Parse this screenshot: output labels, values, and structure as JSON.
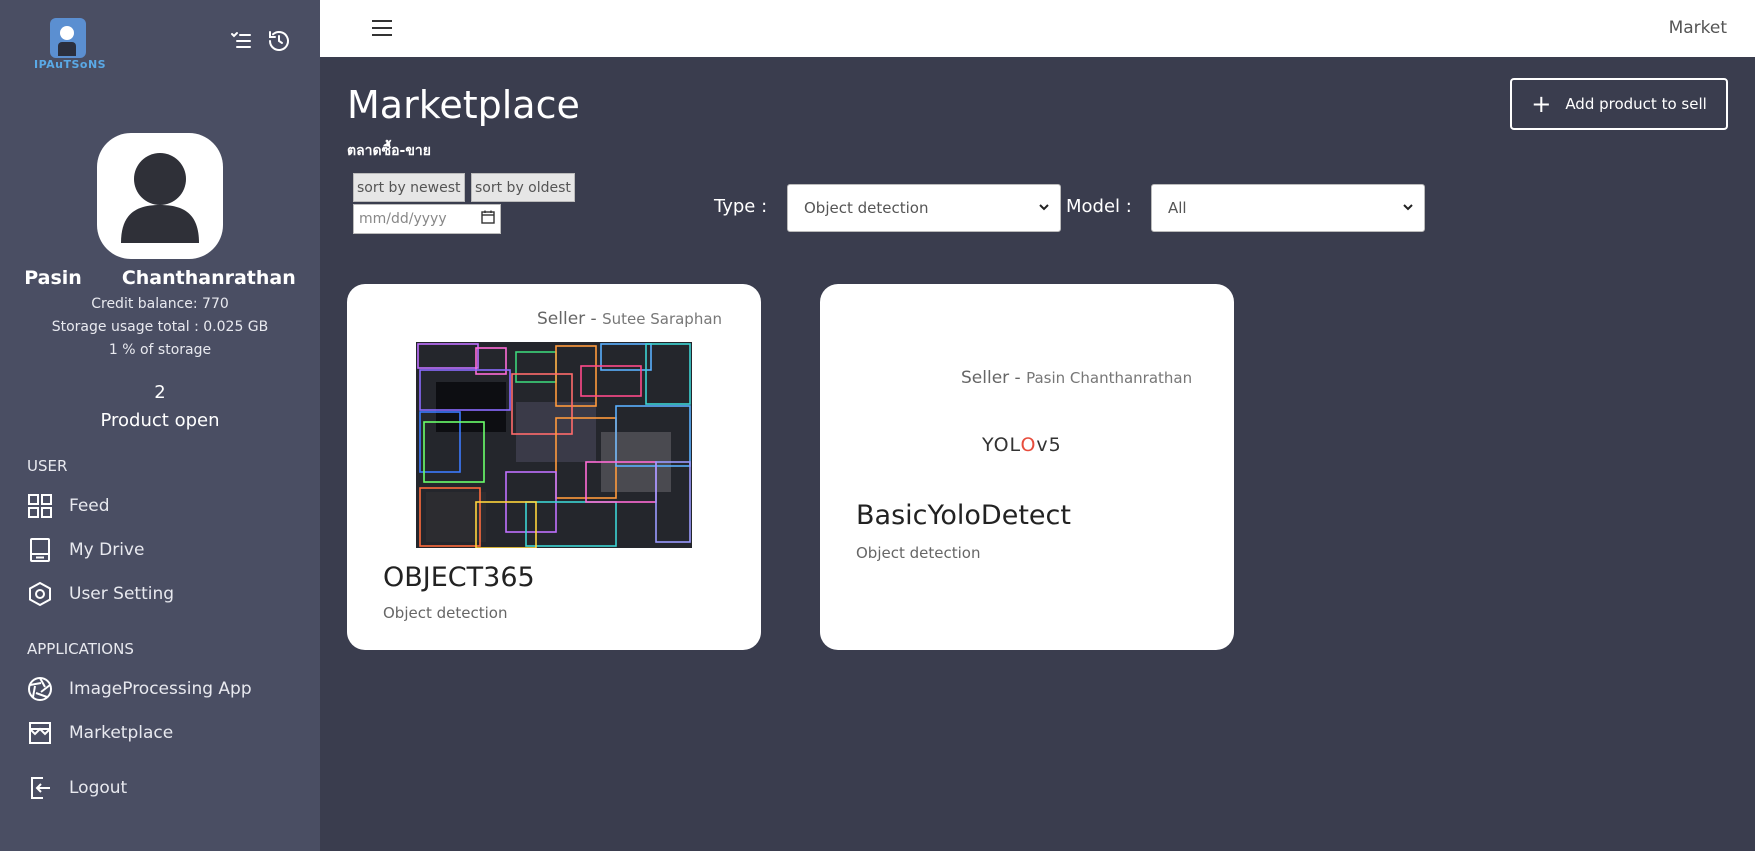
{
  "sidebar": {
    "logo_text": "IPAuTSoNS",
    "user": {
      "first_name": "Pasin",
      "last_name": "Chanthanrathan"
    },
    "credit_balance": "Credit balance: 770",
    "storage_usage": "Storage usage total : 0.025 GB",
    "storage_percent": "1 % of storage",
    "product_count": "2",
    "product_label": "Product open",
    "sections": {
      "user": "USER",
      "applications": "APPLICATIONS"
    },
    "items": [
      {
        "label": "Feed",
        "icon": "grid-icon"
      },
      {
        "label": "My Drive",
        "icon": "drive-icon"
      },
      {
        "label": "User Setting",
        "icon": "hexagon-gear-icon"
      },
      {
        "label": "ImageProcessing App",
        "icon": "aperture-icon"
      },
      {
        "label": "Marketplace",
        "icon": "store-icon"
      },
      {
        "label": "Logout",
        "icon": "logout-icon"
      }
    ]
  },
  "topbar": {
    "right_label": "Market"
  },
  "main": {
    "title": "Marketplace",
    "subtitle": "ตลาดซื้อ-ขาย",
    "add_button": "Add product to sell",
    "sort_newest": "sort by newest",
    "sort_oldest": "sort by oldest",
    "date_placeholder": "mm/dd/yyyy",
    "type_label": "Type :",
    "type_value": "Object detection",
    "model_label": "Model :",
    "model_value": "All"
  },
  "products": [
    {
      "seller_prefix": "Seller - ",
      "seller_name": "Sutee Saraphan",
      "title": "OBJECT365",
      "type": "Object detection"
    },
    {
      "seller_prefix": "Seller - ",
      "seller_name": "Pasin Chanthanrathan",
      "logo_text_a": "YOL",
      "logo_text_b": "O",
      "logo_text_c": "v5",
      "title": "BasicYoloDetect",
      "type": "Object detection"
    }
  ],
  "colors": {
    "sidebar_bg": "#4a4e63",
    "main_bg": "#3a3d4e",
    "card_bg": "#ffffff"
  }
}
